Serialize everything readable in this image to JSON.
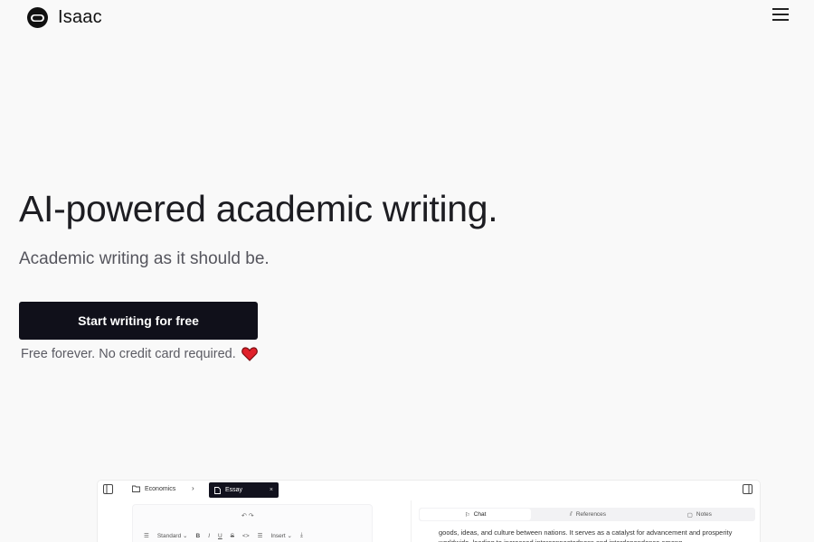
{
  "header": {
    "brand_name": "Isaac",
    "logo_icon": "helmet-logo-icon",
    "menu_icon": "hamburger-menu-icon"
  },
  "hero": {
    "title": "AI-powered academic writing.",
    "subtitle": "Academic writing as it should be.",
    "cta_label": "Start writing for free",
    "cta_note": "Free forever. No credit card required.",
    "note_icon": "heart-icon"
  },
  "preview": {
    "folder_label": "Economics",
    "tab_label": "Essay",
    "undo_redo": "↶ ↷",
    "toolbar": {
      "style_select": "Standard",
      "insert_select": "Insert"
    },
    "panel_tabs": [
      {
        "label": "Chat",
        "icon": "chat-icon"
      },
      {
        "label": "References",
        "icon": "references-icon"
      },
      {
        "label": "Notes",
        "icon": "notes-icon"
      }
    ],
    "panel_text": "goods, ideas, and culture between nations. It serves as a catalyst for advancement and prosperity worldwide, leading to increased interconnectedness and interdependence among"
  },
  "colors": {
    "background": "#f9f9f9",
    "cta_bg": "#10101a",
    "heart": "#e0202a"
  }
}
